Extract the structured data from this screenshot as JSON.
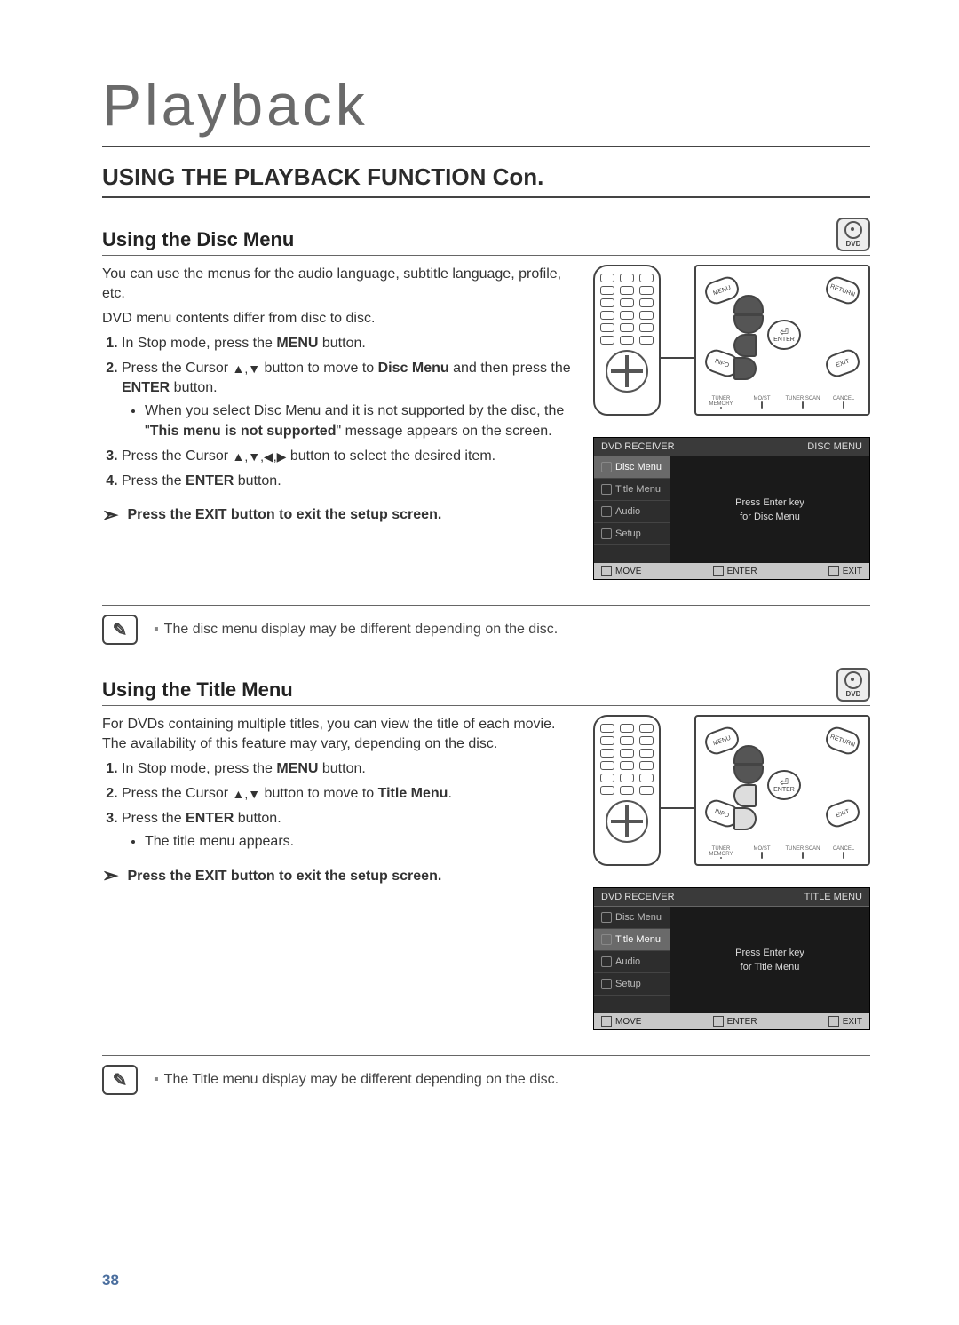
{
  "page_title": "Playback",
  "section_heading": "USING THE PLAYBACK FUNCTION Con.",
  "dvd_label": "DVD",
  "page_number": "38",
  "disc_menu": {
    "title": "Using the Disc Menu",
    "intro1": "You can use the menus for the audio language, subtitle language, profile, etc.",
    "intro2": "DVD menu contents differ from disc to disc.",
    "step1_pre": "In Stop mode, press the ",
    "step1_bold": "MENU",
    "step1_post": " button.",
    "step2_pre": "Press the Cursor ",
    "step2_mid": " button to move to ",
    "step2_bold1": "Disc Menu",
    "step2_mid2": " and then press the ",
    "step2_bold2": "ENTER",
    "step2_post": " button.",
    "bullet_pre": "When you select Disc Menu and it is not supported by the disc, the \"",
    "bullet_bold": "This menu is not supported",
    "bullet_post": "\" message appears on the screen.",
    "step3_pre": "Press the Cursor ",
    "step3_post": " button to select the desired item.",
    "step4_pre": "Press the ",
    "step4_bold": "ENTER",
    "step4_post": " button.",
    "tip": "Press the EXIT button to exit the setup screen.",
    "note": "The disc menu display may be different depending on the disc."
  },
  "title_menu": {
    "title": "Using the Title Menu",
    "intro": "For DVDs containing multiple titles, you can view the title of each movie. The availability of this feature may vary, depending on the disc.",
    "step1_pre": "In Stop mode, press the ",
    "step1_bold": "MENU",
    "step1_post": " button.",
    "step2_pre": "Press the Cursor ",
    "step2_mid": " button to move to ",
    "step2_bold": "Title Menu",
    "step2_post": ".",
    "step3_pre": "Press the ",
    "step3_bold": "ENTER",
    "step3_post": " button.",
    "bullet": "The title menu appears.",
    "tip": "Press the EXIT button to exit the setup screen.",
    "note": "The Title menu display may be different depending on the disc."
  },
  "controller": {
    "menu": "MENU",
    "return": "RETURN",
    "info": "INFO",
    "exit": "EXIT",
    "enter": "ENTER",
    "bot1": "TUNER MEMORY",
    "bot2": "MO/ST",
    "bot3": "TUNER SCAN",
    "bot4": "CANCEL"
  },
  "osd1": {
    "hdr_left": "DVD RECEIVER",
    "hdr_right": "DISC MENU",
    "side": [
      "Disc Menu",
      "Title Menu",
      "Audio",
      "Setup"
    ],
    "active_index": 0,
    "main1": "Press Enter key",
    "main2": "for Disc Menu",
    "f_move": "MOVE",
    "f_enter": "ENTER",
    "f_exit": "EXIT"
  },
  "osd2": {
    "hdr_left": "DVD RECEIVER",
    "hdr_right": "TITLE MENU",
    "side": [
      "Disc Menu",
      "Title Menu",
      "Audio",
      "Setup"
    ],
    "active_index": 1,
    "main1": "Press Enter key",
    "main2": "for Title Menu",
    "f_move": "MOVE",
    "f_enter": "ENTER",
    "f_exit": "EXIT"
  }
}
